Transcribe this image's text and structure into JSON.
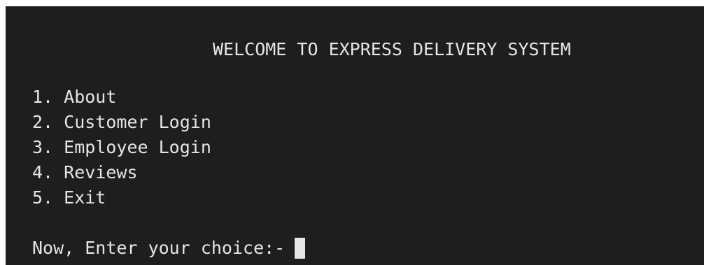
{
  "terminal": {
    "title": "WELCOME TO EXPRESS DELIVERY SYSTEM",
    "menu_items": [
      {
        "label": "1. About"
      },
      {
        "label": "2. Customer Login"
      },
      {
        "label": "3. Employee Login"
      },
      {
        "label": "4. Reviews"
      },
      {
        "label": "5. Exit"
      }
    ],
    "prompt": "Now, Enter your choice:-",
    "input_value": ""
  },
  "colors": {
    "background": "#1e1e1e",
    "foreground": "#e6e6e6"
  }
}
